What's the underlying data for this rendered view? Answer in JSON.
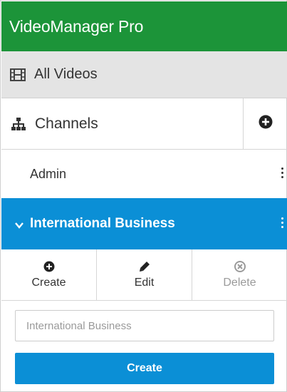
{
  "app": {
    "title": "VideoManager Pro"
  },
  "nav": {
    "all_videos": {
      "label": "All Videos",
      "icon": "film-icon"
    },
    "channels": {
      "label": "Channels",
      "icon": "sitemap-icon",
      "add_icon": "plus-circle-icon"
    }
  },
  "channel_list": [
    {
      "label": "Admin",
      "selected": false
    },
    {
      "label": "International Business",
      "selected": true
    }
  ],
  "actions": [
    {
      "label": "Create",
      "icon": "plus-circle-icon",
      "enabled": true
    },
    {
      "label": "Edit",
      "icon": "pencil-icon",
      "enabled": true
    },
    {
      "label": "Delete",
      "icon": "times-circle-icon",
      "enabled": false
    }
  ],
  "form": {
    "name_value": "",
    "name_placeholder": "International Business",
    "submit_label": "Create"
  },
  "colors": {
    "header_bg": "#1c9439",
    "accent_blue": "#0b8fd6",
    "nav_bg": "#e4e4e4"
  }
}
